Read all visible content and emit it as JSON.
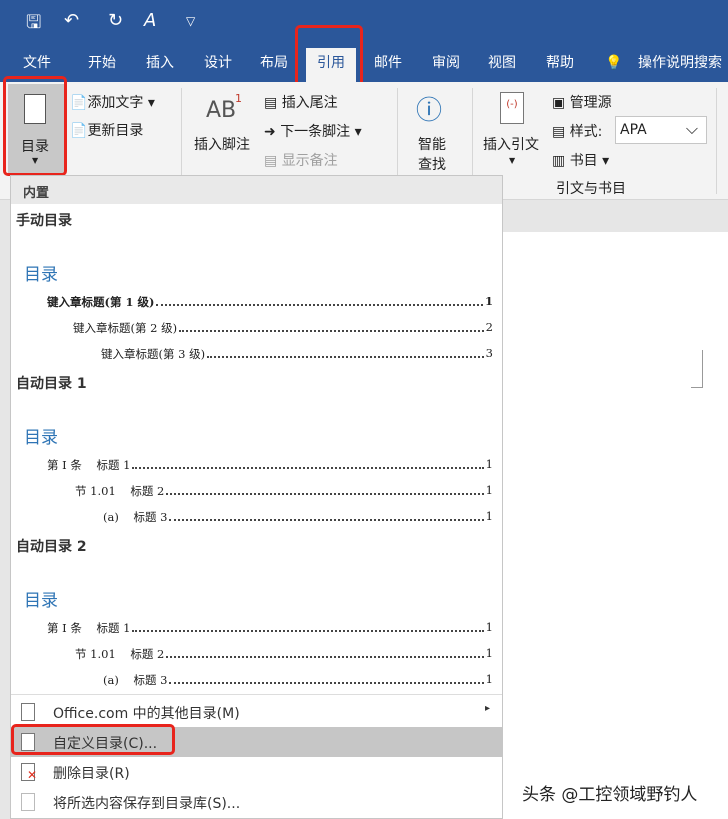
{
  "quick_access": {
    "save": "🖫",
    "undo": "↶",
    "redo": "↻",
    "format": "A",
    "customize": "▽"
  },
  "tabs": [
    "文件",
    "开始",
    "插入",
    "设计",
    "布局",
    "引用",
    "邮件",
    "审阅",
    "视图",
    "帮助"
  ],
  "search": "操作说明搜索",
  "ribbon": {
    "toc": "目录",
    "add_text": "添加文字",
    "update_toc": "更新目录",
    "insert_footnote": "插入脚注",
    "insert_endnote": "插入尾注",
    "next_footnote": "下一条脚注",
    "show_notes": "显示备注",
    "smart_lookup_1": "智能",
    "smart_lookup_2": "查找",
    "insert_citation": "插入引文",
    "manage_sources": "管理源",
    "style_label": "样式:",
    "style_value": "APA",
    "bibliography": "书目",
    "group_citations": "引文与书目",
    "ab": "AB",
    "sup": "1"
  },
  "menu": {
    "builtin": "内置",
    "manual": {
      "name": "手动目录",
      "title": "目录",
      "rows": [
        {
          "text": "键入章标题(第 1 级)",
          "page": "1"
        },
        {
          "text": "键入章标题(第 2 级)",
          "page": "2"
        },
        {
          "text": "键入章标题(第 3 级)",
          "page": "3"
        }
      ]
    },
    "auto1": {
      "name": "自动目录 1",
      "title": "目录",
      "rows": [
        {
          "text": "第 I 条    标题 1",
          "page": "1"
        },
        {
          "text": "节 1.01    标题 2",
          "page": "1"
        },
        {
          "text": "(a)    标题 3",
          "page": "1"
        }
      ]
    },
    "auto2": {
      "name": "自动目录 2",
      "title": "目录",
      "rows": [
        {
          "text": "第 I 条    标题 1",
          "page": "1"
        },
        {
          "text": "节 1.01    标题 2",
          "page": "1"
        },
        {
          "text": "(a)    标题 3",
          "page": "1"
        }
      ]
    },
    "items": [
      "Office.com 中的其他目录(M)",
      "自定义目录(C)...",
      "删除目录(R)",
      "将所选内容保存到目录库(S)..."
    ]
  },
  "watermark": "头条 @工控领域野钓人"
}
